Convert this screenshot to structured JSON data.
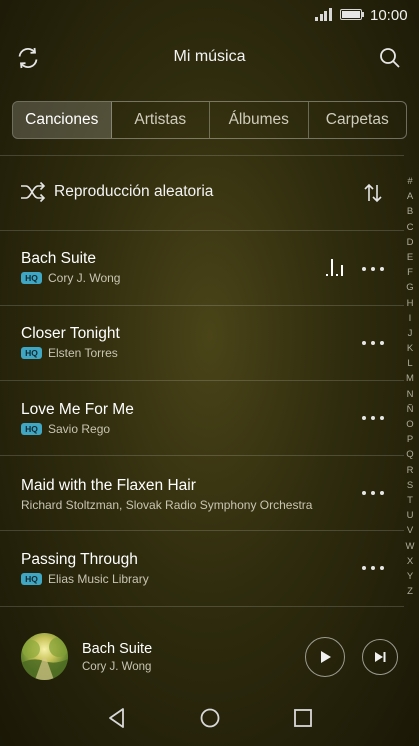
{
  "status": {
    "time": "10:00",
    "icons": [
      "signal-icon",
      "battery-icon"
    ]
  },
  "header": {
    "title": "Mi música",
    "left_icon": "refresh-icon",
    "right_icon": "search-icon"
  },
  "tabs": [
    {
      "label": "Canciones",
      "active": true
    },
    {
      "label": "Artistas",
      "active": false
    },
    {
      "label": "Álbumes",
      "active": false
    },
    {
      "label": "Carpetas",
      "active": false
    }
  ],
  "shuffle": {
    "label": "Reproducción aleatoria",
    "icon": "shuffle-icon",
    "sort_icon": "sort-icon"
  },
  "songs": [
    {
      "title": "Bach Suite",
      "artist": "Cory J. Wong",
      "hq": true,
      "hq_label": "HQ",
      "playing": true
    },
    {
      "title": "Closer Tonight",
      "artist": "Elsten Torres",
      "hq": true,
      "hq_label": "HQ",
      "playing": false
    },
    {
      "title": "Love Me For Me",
      "artist": "Savio Rego",
      "hq": true,
      "hq_label": "HQ",
      "playing": false
    },
    {
      "title": "Maid with the Flaxen Hair",
      "artist": "Richard Stoltzman, Slovak Radio Symphony Orchestra",
      "hq": false,
      "hq_label": "",
      "playing": false
    },
    {
      "title": "Passing Through",
      "artist": "Elias Music Library",
      "hq": true,
      "hq_label": "HQ",
      "playing": false
    }
  ],
  "alphabet": [
    "#",
    "A",
    "B",
    "C",
    "D",
    "E",
    "F",
    "G",
    "H",
    "I",
    "J",
    "K",
    "L",
    "M",
    "N",
    "Ñ",
    "O",
    "P",
    "Q",
    "R",
    "S",
    "T",
    "U",
    "V",
    "W",
    "X",
    "Y",
    "Z"
  ],
  "now_playing": {
    "title": "Bach Suite",
    "artist": "Cory J. Wong"
  },
  "colors": {
    "hq_badge": "#3fa7c3",
    "background": "#2f2c0e",
    "active_tab": "rgba(255,255,255,0.18)"
  }
}
